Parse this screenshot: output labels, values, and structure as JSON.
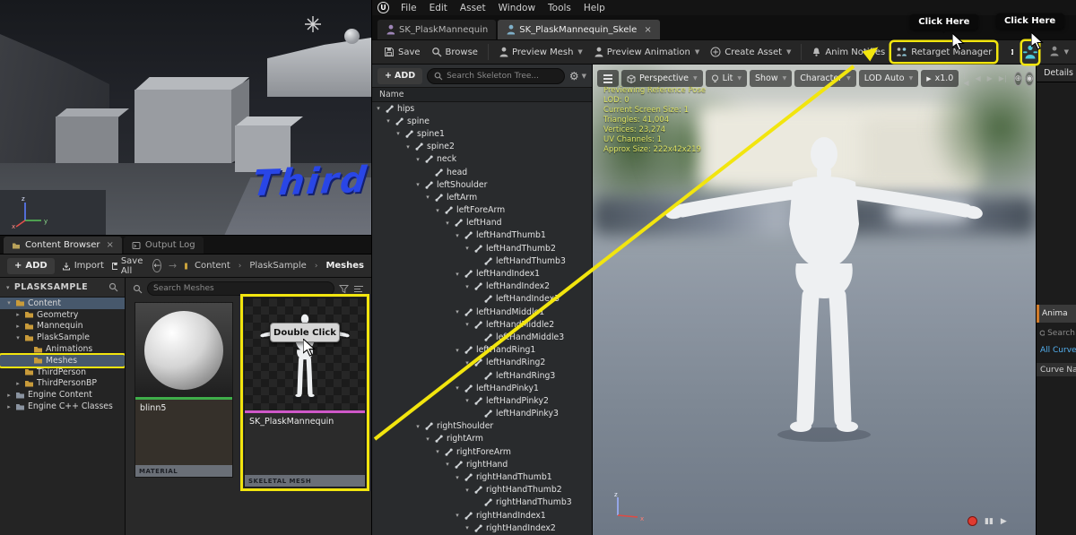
{
  "level_viewport": {
    "map_text": "Third",
    "axis": {
      "x": "x",
      "y": "y",
      "z": "z"
    }
  },
  "content_browser": {
    "tabs": [
      {
        "label": "Content Browser",
        "close": "×"
      },
      {
        "label": "Output Log"
      }
    ],
    "toolbar": {
      "add": "ADD",
      "import": "Import",
      "save_all": "Save All"
    },
    "breadcrumb": [
      "Content",
      "PlaskSample",
      "Meshes"
    ],
    "sidebar": {
      "header": "PLASKSAMPLE",
      "items": [
        {
          "label": "Content",
          "level": 0,
          "cls": "expanded selected"
        },
        {
          "label": "Geometry",
          "level": 1,
          "cls": "collapsed"
        },
        {
          "label": "Mannequin",
          "level": 1,
          "cls": "collapsed"
        },
        {
          "label": "PlaskSample",
          "level": 1,
          "cls": "expanded"
        },
        {
          "label": "Animations",
          "level": 2,
          "cls": ""
        },
        {
          "label": "Meshes",
          "level": 2,
          "cls": "selected highlighted"
        },
        {
          "label": "ThirdPerson",
          "level": 1,
          "cls": ""
        },
        {
          "label": "ThirdPersonBP",
          "level": 1,
          "cls": "collapsed"
        },
        {
          "label": "Engine Content",
          "level": 0,
          "cls": "collapsed engine"
        },
        {
          "label": "Engine C++ Classes",
          "level": 0,
          "cls": "collapsed engine"
        }
      ]
    },
    "search_placeholder": "Search Meshes",
    "assets": [
      {
        "name": "blinn5",
        "type": "MATERIAL"
      },
      {
        "name": "SK_PlaskMannequin",
        "type": "SKELETAL MESH"
      }
    ]
  },
  "editor": {
    "menu": [
      "File",
      "Edit",
      "Asset",
      "Window",
      "Tools",
      "Help"
    ],
    "logo": "U",
    "tabs": [
      {
        "label": "SK_PlaskMannequin"
      },
      {
        "label": "SK_PlaskMannequin_Skele",
        "close": "×"
      }
    ],
    "toolbar": {
      "save": "Save",
      "browse": "Browse",
      "preview_mesh": "Preview Mesh",
      "preview_animation": "Preview Animation",
      "create_asset": "Create Asset",
      "anim_notifies": "Anim Notifies",
      "retarget_manager": "Retarget Manager"
    }
  },
  "skeleton_panel": {
    "add_button": "ADD",
    "search_placeholder": "Search Skeleton Tree...",
    "column_header": "Name",
    "bones": [
      {
        "name": "hips",
        "level": 0
      },
      {
        "name": "spine",
        "level": 1
      },
      {
        "name": "spine1",
        "level": 2
      },
      {
        "name": "spine2",
        "level": 3
      },
      {
        "name": "neck",
        "level": 4
      },
      {
        "name": "head",
        "level": 5,
        "cls": "leaf"
      },
      {
        "name": "leftShoulder",
        "level": 4
      },
      {
        "name": "leftArm",
        "level": 5
      },
      {
        "name": "leftForeArm",
        "level": 6
      },
      {
        "name": "leftHand",
        "level": 7
      },
      {
        "name": "leftHandThumb1",
        "level": 8
      },
      {
        "name": "leftHandThumb2",
        "level": 9
      },
      {
        "name": "leftHandThumb3",
        "level": 10,
        "cls": "leaf"
      },
      {
        "name": "leftHandIndex1",
        "level": 8
      },
      {
        "name": "leftHandIndex2",
        "level": 9
      },
      {
        "name": "leftHandIndex3",
        "level": 10,
        "cls": "leaf"
      },
      {
        "name": "leftHandMiddle1",
        "level": 8
      },
      {
        "name": "leftHandMiddle2",
        "level": 9
      },
      {
        "name": "leftHandMiddle3",
        "level": 10,
        "cls": "leaf"
      },
      {
        "name": "leftHandRing1",
        "level": 8
      },
      {
        "name": "leftHandRing2",
        "level": 9
      },
      {
        "name": "leftHandRing3",
        "level": 10,
        "cls": "leaf"
      },
      {
        "name": "leftHandPinky1",
        "level": 8
      },
      {
        "name": "leftHandPinky2",
        "level": 9
      },
      {
        "name": "leftHandPinky3",
        "level": 10,
        "cls": "leaf"
      },
      {
        "name": "rightShoulder",
        "level": 4
      },
      {
        "name": "rightArm",
        "level": 5
      },
      {
        "name": "rightForeArm",
        "level": 6
      },
      {
        "name": "rightHand",
        "level": 7
      },
      {
        "name": "rightHandThumb1",
        "level": 8
      },
      {
        "name": "rightHandThumb2",
        "level": 9
      },
      {
        "name": "rightHandThumb3",
        "level": 10,
        "cls": "leaf"
      },
      {
        "name": "rightHandIndex1",
        "level": 8
      },
      {
        "name": "rightHandIndex2",
        "level": 9
      }
    ]
  },
  "preview": {
    "toolbar": {
      "perspective": "Perspective",
      "lit": "Lit",
      "show": "Show",
      "character": "Character",
      "lod": "LOD Auto",
      "speed": "x1.0"
    },
    "stats": [
      "Previewing Reference Pose",
      "LOD: 0",
      "Current Screen Size: 1",
      "Triangles: 41,004",
      "Vertices: 23,274",
      "UV Channels: 1",
      "Approx Size: 222x42x219"
    ],
    "axis": {
      "x": "x",
      "z": "z"
    }
  },
  "right_panel": {
    "details": "Details",
    "anim_tab": "Anima",
    "search_placeholder": "Search",
    "all_curves": "All Curves",
    "curve_name": "Curve Nam"
  },
  "annotations": {
    "click_here_left": "Click Here",
    "click_here_right": "Click Here",
    "double_click": "Double Click"
  },
  "colors": {
    "annotation_yellow": "#f2e50e",
    "material_green": "#3fae4a",
    "skeletal_pink": "#cf58c9",
    "selection_blue": "#47586c"
  }
}
